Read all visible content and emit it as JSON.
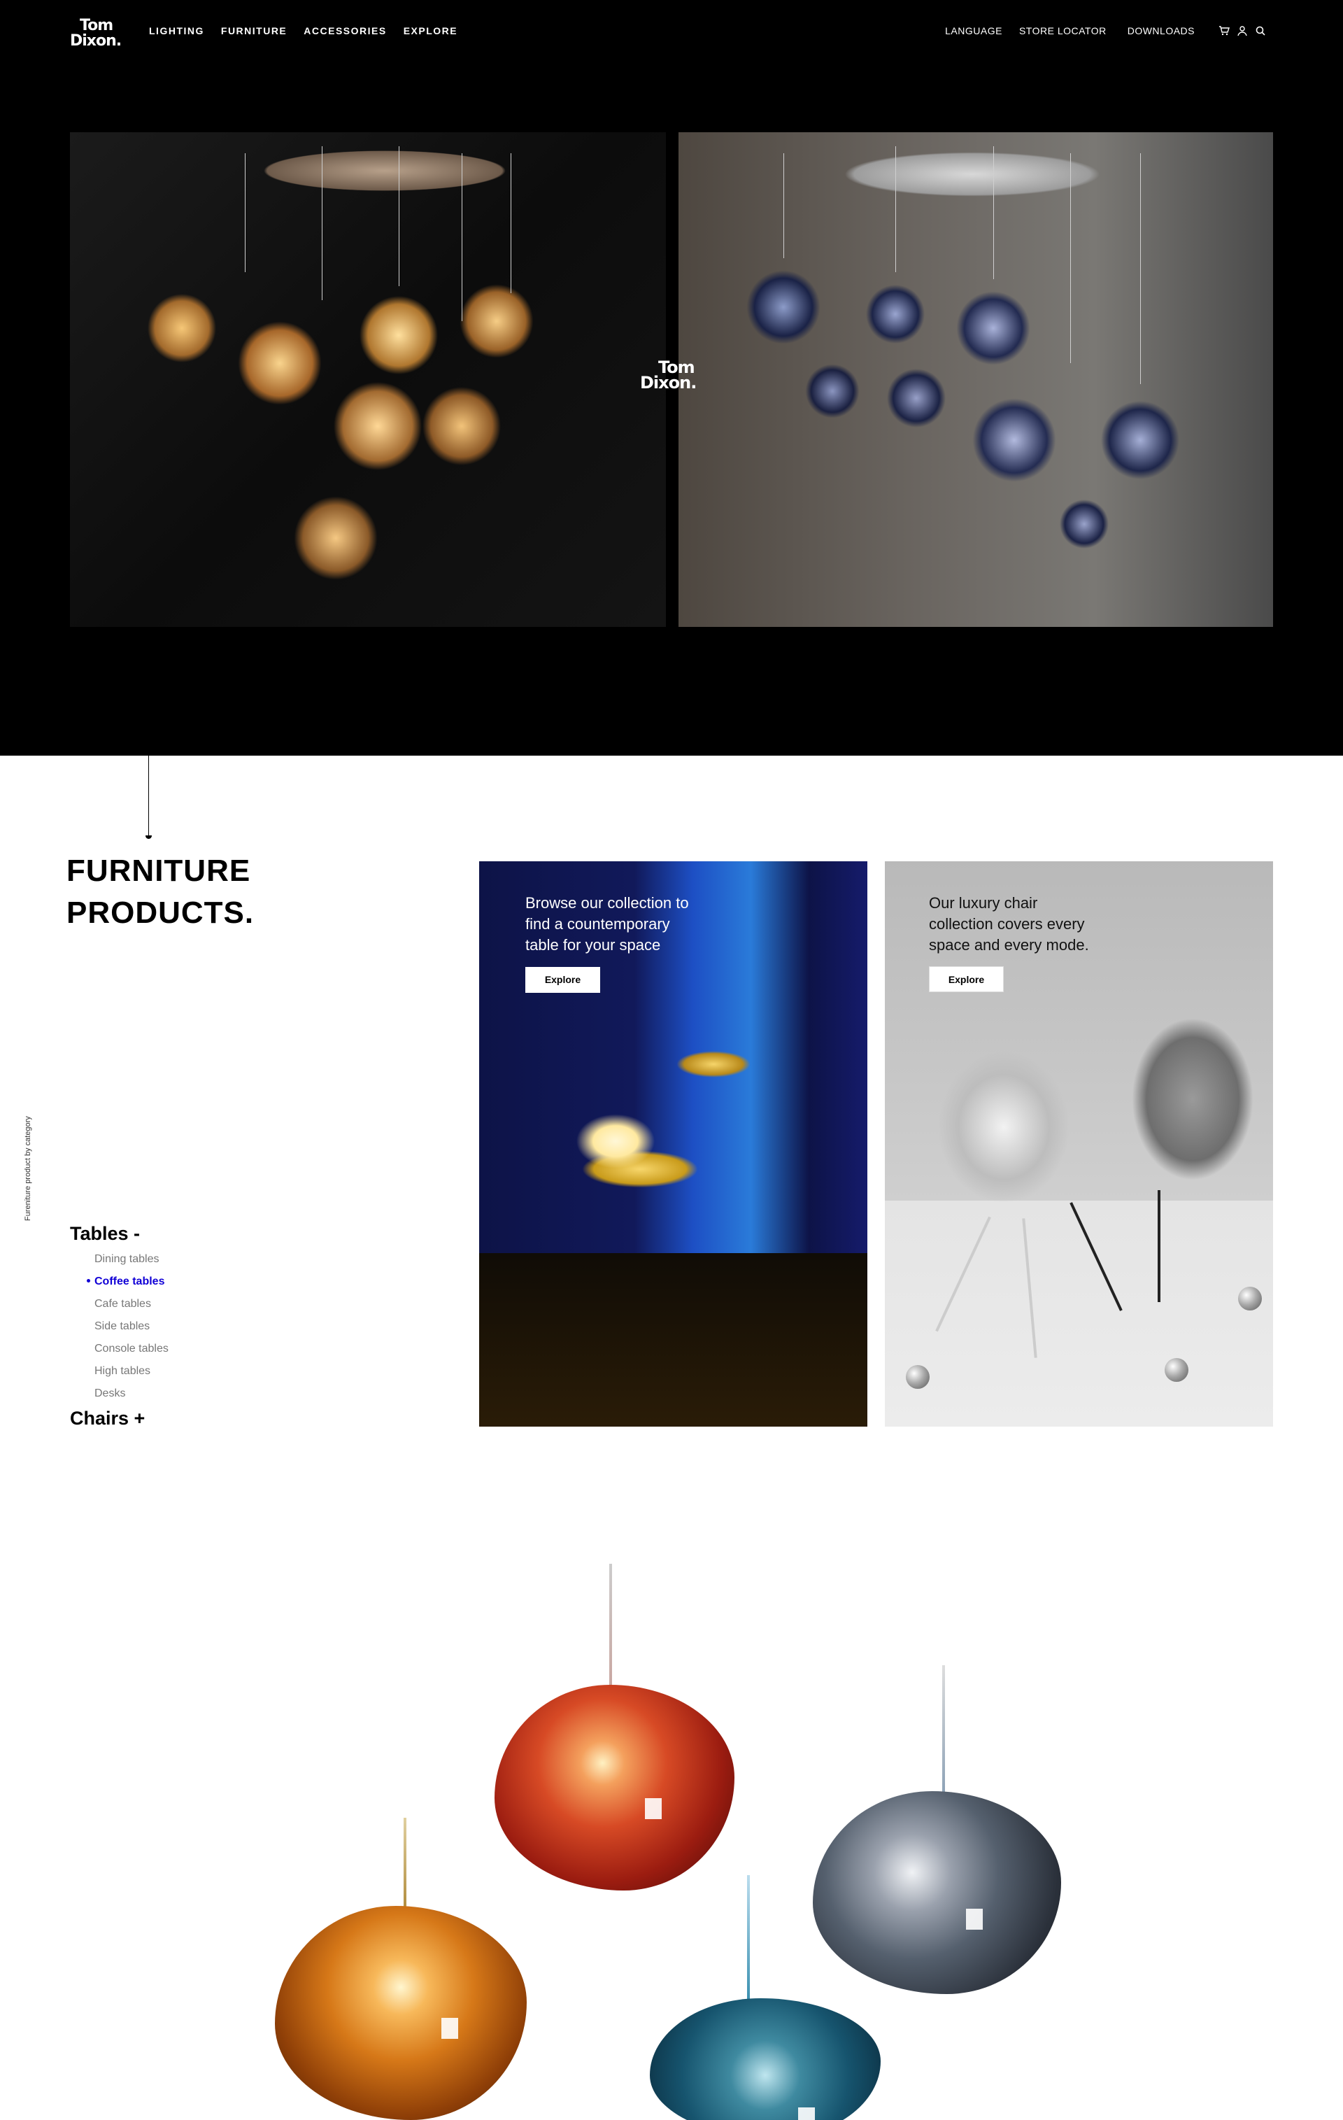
{
  "brand": {
    "logo_line1": "Tom",
    "logo_line2": "Dixon."
  },
  "nav": {
    "primary": [
      "LIGHTING",
      "FURNITURE",
      "ACCESSORIES",
      "EXPLORE"
    ],
    "secondary": [
      "LANGUAGE",
      "STORE LOCATOR",
      "DOWNLOADS"
    ],
    "icons": [
      "cart-icon",
      "user-icon",
      "search-icon"
    ]
  },
  "hero": {
    "left_image": "Cut pendant lights chandelier",
    "right_image": "Melt pendant lights in smoke",
    "center_logo_line1": "Tom",
    "center_logo_line2": "Dixon."
  },
  "furniture": {
    "title_line1": "FURNITURE",
    "title_line2": "PRODUCTS.",
    "side_label": "Fureniture product by category",
    "categories": [
      {
        "label": "Tables -",
        "items": [
          "Dining tables",
          "Coffee tables",
          "Cafe tables",
          "Side tables",
          "Console tables",
          "High tables",
          "Desks"
        ],
        "active": "Coffee tables"
      },
      {
        "label": "Chairs +"
      }
    ],
    "cards": [
      {
        "blurb": "Browse our collection to find a countemporary table for your space",
        "button": "Explore"
      },
      {
        "blurb": "Our luxury chair collection covers every space and every mode.",
        "button": "Explore"
      }
    ]
  },
  "colors": {
    "accent": "#1100d6",
    "hero_bg": "#000000"
  }
}
